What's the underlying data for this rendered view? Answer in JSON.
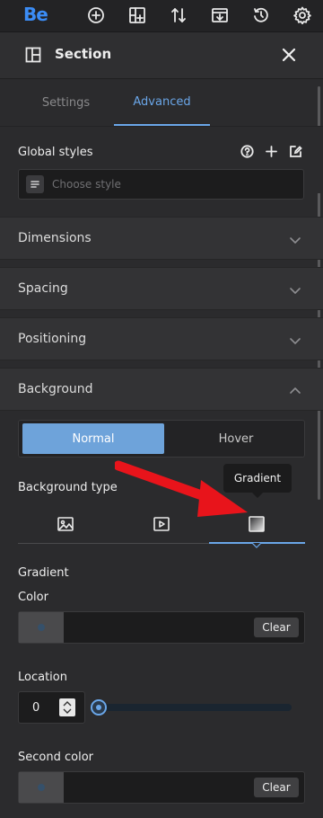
{
  "app": {
    "logo": "Be"
  },
  "toolbar": {
    "icons": [
      "plus-circle-icon",
      "add-section-icon",
      "sort-icon",
      "import-icon",
      "history-icon",
      "settings-gear-icon"
    ]
  },
  "panel": {
    "title": "Section"
  },
  "tabs": [
    {
      "label": "Settings",
      "active": false
    },
    {
      "label": "Advanced",
      "active": true
    }
  ],
  "global_styles": {
    "label": "Global styles",
    "placeholder": "Choose style"
  },
  "accordions": [
    {
      "label": "Dimensions",
      "expanded": false
    },
    {
      "label": "Spacing",
      "expanded": false
    },
    {
      "label": "Positioning",
      "expanded": false
    },
    {
      "label": "Background",
      "expanded": true
    }
  ],
  "background": {
    "states": [
      {
        "label": "Normal",
        "active": true
      },
      {
        "label": "Hover",
        "active": false
      }
    ],
    "type_label": "Background type",
    "tooltip": "Gradient",
    "types": [
      "image-icon",
      "video-icon",
      "gradient-icon"
    ],
    "active_type": "gradient",
    "gradient_heading": "Gradient",
    "color_label": "Color",
    "clear_label": "Clear",
    "location_label": "Location",
    "location_value": "0",
    "location_level": 0,
    "second_color_label": "Second color"
  },
  "colors": {
    "accent": "#6aa6e8",
    "active_state": "#6ea3da",
    "annotation_arrow": "#e8141b"
  }
}
